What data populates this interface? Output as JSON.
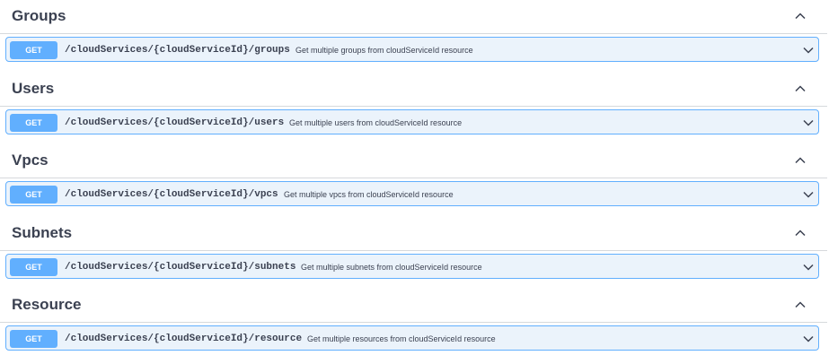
{
  "sections": [
    {
      "title": "Groups",
      "method": "GET",
      "path": "/cloudServices/{cloudServiceId}/groups",
      "summary": "Get multiple groups from cloudServiceId resource"
    },
    {
      "title": "Users",
      "method": "GET",
      "path": "/cloudServices/{cloudServiceId}/users",
      "summary": "Get multiple users from cloudServiceId resource"
    },
    {
      "title": "Vpcs",
      "method": "GET",
      "path": "/cloudServices/{cloudServiceId}/vpcs",
      "summary": "Get multiple vpcs from cloudServiceId resource"
    },
    {
      "title": "Subnets",
      "method": "GET",
      "path": "/cloudServices/{cloudServiceId}/subnets",
      "summary": "Get multiple subnets from cloudServiceId resource"
    },
    {
      "title": "Resource",
      "method": "GET",
      "path": "/cloudServices/{cloudServiceId}/resource",
      "summary": "Get multiple resources from cloudServiceId resource"
    }
  ],
  "icons": {
    "collapse": "chevron-up-icon",
    "expand": "chevron-down-icon"
  },
  "colors": {
    "get_method": "#61affe",
    "get_background": "#ebf3fb",
    "text": "#3b4151"
  }
}
